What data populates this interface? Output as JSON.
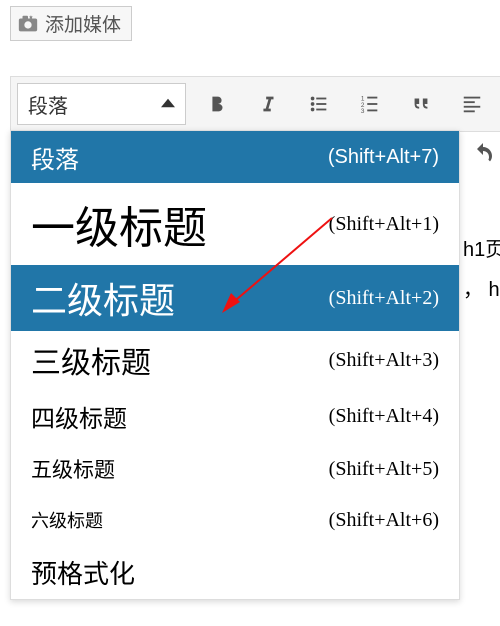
{
  "add_media_label": "添加媒体",
  "format_selected": "段落",
  "content_peek_line1": "h1页",
  "content_peek_line2": "， h",
  "dropdown": {
    "paragraph": {
      "label": "段落",
      "shortcut": "(Shift+Alt+7)"
    },
    "heading1": {
      "label": "一级标题",
      "shortcut": "(Shift+Alt+1)"
    },
    "heading2": {
      "label": "二级标题",
      "shortcut": "(Shift+Alt+2)"
    },
    "heading3": {
      "label": "三级标题",
      "shortcut": "(Shift+Alt+3)"
    },
    "heading4": {
      "label": "四级标题",
      "shortcut": "(Shift+Alt+4)"
    },
    "heading5": {
      "label": "五级标题",
      "shortcut": "(Shift+Alt+5)"
    },
    "heading6": {
      "label": "六级标题",
      "shortcut": "(Shift+Alt+6)"
    },
    "preformatted": {
      "label": "预格式化",
      "shortcut": ""
    }
  }
}
